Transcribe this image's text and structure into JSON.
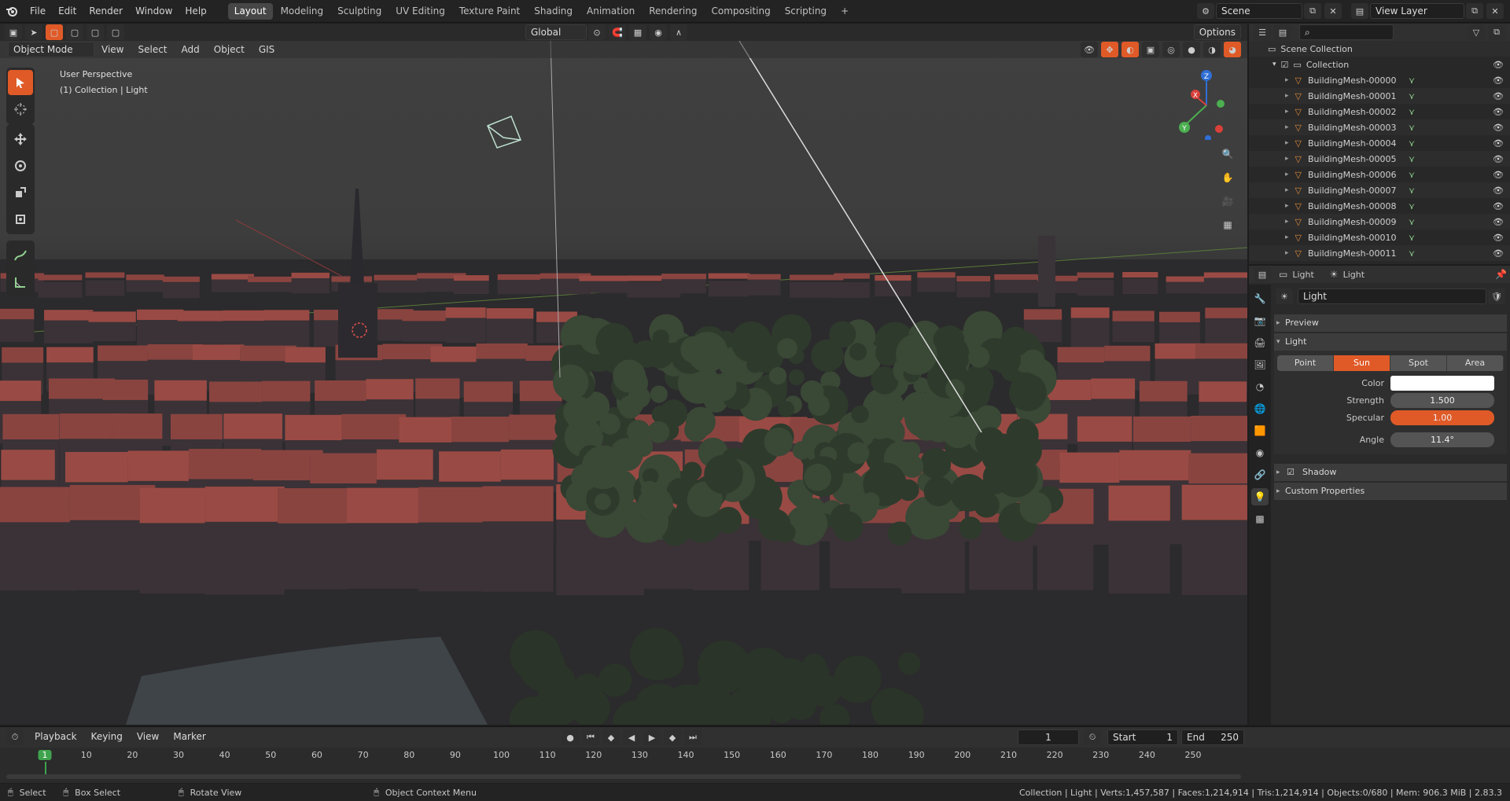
{
  "app": {
    "scene": "Scene",
    "view_layer": "View Layer"
  },
  "menus": [
    "File",
    "Edit",
    "Render",
    "Window",
    "Help"
  ],
  "workspaces": [
    {
      "label": "Layout",
      "active": true
    },
    {
      "label": "Modeling"
    },
    {
      "label": "Sculpting"
    },
    {
      "label": "UV Editing"
    },
    {
      "label": "Texture Paint"
    },
    {
      "label": "Shading"
    },
    {
      "label": "Animation"
    },
    {
      "label": "Rendering"
    },
    {
      "label": "Compositing"
    },
    {
      "label": "Scripting"
    }
  ],
  "viewport": {
    "transform_orientation": "Global",
    "options_label": "Options",
    "mode": "Object Mode",
    "menu": [
      "View",
      "Select",
      "Add",
      "Object",
      "GIS"
    ],
    "overlay_line1": "User Perspective",
    "overlay_line2": "(1) Collection | Light",
    "gizmo": {
      "x": "X",
      "y": "Y",
      "z": "Z"
    }
  },
  "outliner": {
    "root": "Scene Collection",
    "collection": "Collection",
    "items": [
      "BuildingMesh-00000",
      "BuildingMesh-00001",
      "BuildingMesh-00002",
      "BuildingMesh-00003",
      "BuildingMesh-00004",
      "BuildingMesh-00005",
      "BuildingMesh-00006",
      "BuildingMesh-00007",
      "BuildingMesh-00008",
      "BuildingMesh-00009",
      "BuildingMesh-00010",
      "BuildingMesh-00011"
    ],
    "search_placeholder": ""
  },
  "properties": {
    "breadcrumb_object": "Light",
    "breadcrumb_data": "Light",
    "datablock": "Light",
    "panels": {
      "preview": "Preview",
      "light": "Light",
      "shadow": "Shadow",
      "custom": "Custom Properties"
    },
    "light_types": [
      {
        "label": "Point"
      },
      {
        "label": "Sun",
        "active": true
      },
      {
        "label": "Spot"
      },
      {
        "label": "Area"
      }
    ],
    "color_label": "Color",
    "color_value": "#ffffff",
    "strength_label": "Strength",
    "strength": "1.500",
    "specular_label": "Specular",
    "specular": "1.00",
    "specular_fraction": 1.0,
    "angle_label": "Angle",
    "angle": "11.4°",
    "shadow_checked": true
  },
  "timeline": {
    "menus": [
      "Playback",
      "Keying",
      "View",
      "Marker"
    ],
    "current_frame": "1",
    "start_label": "Start",
    "start": "1",
    "end_label": "End",
    "end": "250",
    "ticks": [
      "1",
      "10",
      "20",
      "30",
      "40",
      "50",
      "60",
      "70",
      "80",
      "90",
      "100",
      "110",
      "120",
      "130",
      "140",
      "150",
      "160",
      "170",
      "180",
      "190",
      "200",
      "210",
      "220",
      "230",
      "240",
      "250"
    ]
  },
  "statusbar": {
    "select": "Select",
    "box_select": "Box Select",
    "rotate_view": "Rotate View",
    "context_menu": "Object Context Menu",
    "stats": "Collection | Light | Verts:1,457,587 | Faces:1,214,914 | Tris:1,214,914 | Objects:0/680 | Mem: 906.3 MiB | 2.83.3"
  },
  "colors": {
    "accent": "#e05a28",
    "panel": "#2a2a2a",
    "header": "#232323",
    "roof": "#9a4a44",
    "tree": "#2e3a2c"
  }
}
